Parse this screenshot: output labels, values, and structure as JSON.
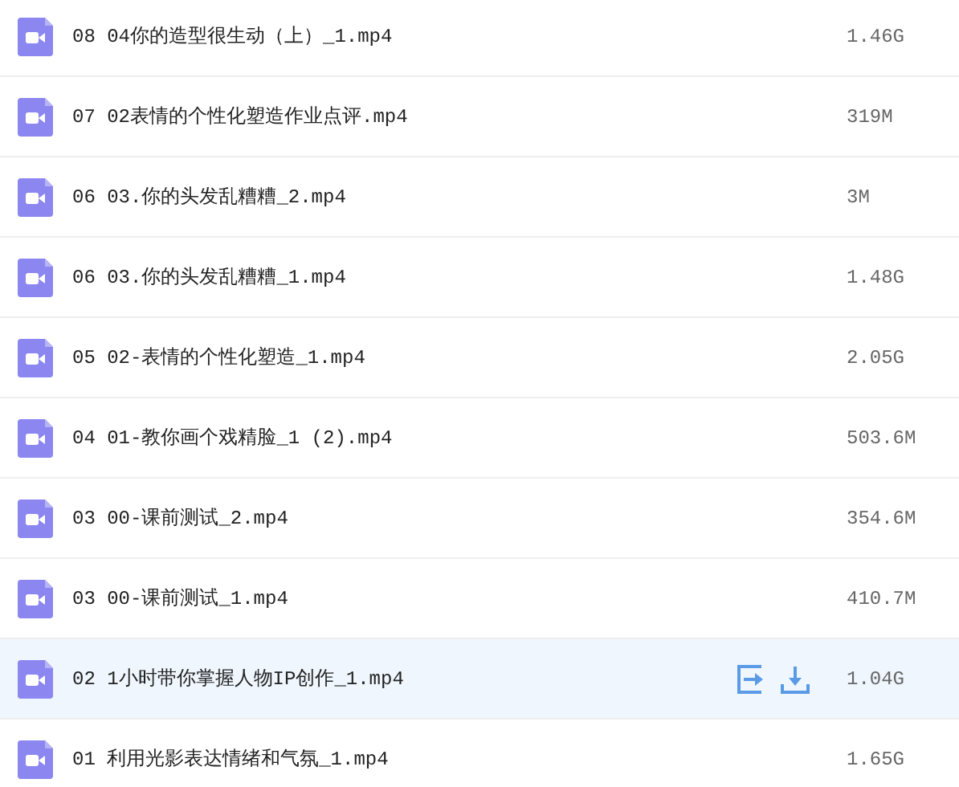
{
  "files": [
    {
      "name": "08 04你的造型很生动（上）_1.mp4",
      "size": "1.46G",
      "hovered": false
    },
    {
      "name": "07 02表情的个性化塑造作业点评.mp4",
      "size": "319M",
      "hovered": false
    },
    {
      "name": "06 03.你的头发乱糟糟_2.mp4",
      "size": "3M",
      "hovered": false
    },
    {
      "name": "06 03.你的头发乱糟糟_1.mp4",
      "size": "1.48G",
      "hovered": false
    },
    {
      "name": "05 02-表情的个性化塑造_1.mp4",
      "size": "2.05G",
      "hovered": false
    },
    {
      "name": "04 01-教你画个戏精脸_1 (2).mp4",
      "size": "503.6M",
      "hovered": false
    },
    {
      "name": "03 00-课前测试_2.mp4",
      "size": "354.6M",
      "hovered": false
    },
    {
      "name": "03 00-课前测试_1.mp4",
      "size": "410.7M",
      "hovered": false
    },
    {
      "name": "02 1小时带你掌握人物IP创作_1.mp4",
      "size": "1.04G",
      "hovered": true
    },
    {
      "name": "01 利用光影表达情绪和气氛_1.mp4",
      "size": "1.65G",
      "hovered": false
    }
  ]
}
